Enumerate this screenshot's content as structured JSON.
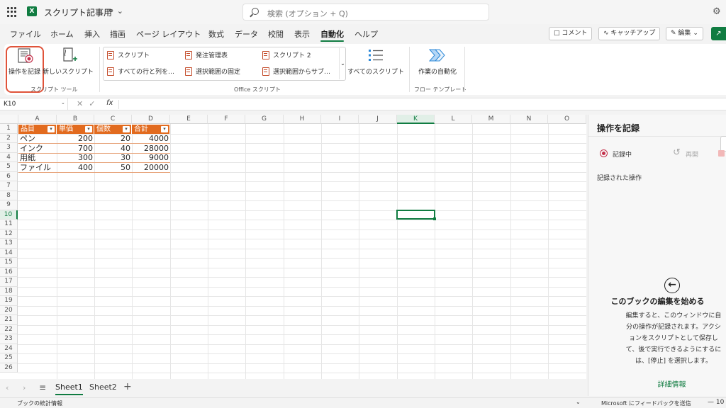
{
  "titlebar": {
    "app_icon": "excel-icon",
    "doc_title": "スクリプト記事用",
    "search_placeholder": "検索 (オプション + Q)"
  },
  "menu": {
    "tabs": [
      "ファイル",
      "ホーム",
      "挿入",
      "描画",
      "ページ レイアウト",
      "数式",
      "データ",
      "校閲",
      "表示",
      "自動化",
      "ヘルプ"
    ],
    "active_tab": "自動化",
    "comment_btn": "コメント",
    "catchup_btn": "キャッチアップ",
    "edit_btn": "編集"
  },
  "ribbon": {
    "record_actions": "操作を記録",
    "new_script": "新しいスクリプト",
    "script_tools_group": "スクリプト ツール",
    "gallery": [
      [
        "スクリプト",
        "発注管理表",
        "スクリプト 2"
      ],
      [
        "すべての行と列を…",
        "選択範囲の固定",
        "選択範囲からサブ…"
      ]
    ],
    "office_scripts_group": "Office スクリプト",
    "all_scripts": "すべてのスクリプト",
    "automate_work": "作業の自動化",
    "flow_templates_group": "フロー テンプレート"
  },
  "formula_bar": {
    "name_box": "K10",
    "fx": "fx",
    "value": ""
  },
  "grid": {
    "columns": [
      "A",
      "B",
      "C",
      "D",
      "E",
      "F",
      "G",
      "H",
      "I",
      "J",
      "K",
      "L",
      "M",
      "N",
      "O"
    ],
    "rows": [
      "1",
      "2",
      "3",
      "4",
      "5",
      "6",
      "7",
      "8",
      "9",
      "10",
      "11",
      "12",
      "13",
      "14",
      "15",
      "16",
      "17",
      "18",
      "19",
      "20",
      "21",
      "22",
      "23",
      "24",
      "25",
      "26"
    ],
    "selected_cell": "K10",
    "table_headers": [
      "品目",
      "単価",
      "個数",
      "合計"
    ],
    "table_rows": [
      [
        "ペン",
        "200",
        "20",
        "4000"
      ],
      [
        "インク",
        "700",
        "40",
        "28000"
      ],
      [
        "用紙",
        "300",
        "30",
        "9000"
      ],
      [
        "ファイル",
        "400",
        "50",
        "20000"
      ]
    ],
    "table_color": "#e26b1f"
  },
  "sheets": {
    "tabs": [
      "Sheet1",
      "Sheet2"
    ],
    "active": "Sheet1"
  },
  "status": {
    "left": "ブックの統計情報",
    "feedback": "Microsoft にフィードバックを送信",
    "zoom": "— 10"
  },
  "pane": {
    "title": "操作を記録",
    "recording": "記録中",
    "replay": "再開",
    "recorded_actions": "記録された操作",
    "empty_title": "このブックの編集を始める",
    "empty_desc": "編集すると、このウィンドウに自分の操作が記録されます。アクションをスクリプトとして保存して、後で実行できるようにするには、[停止] を選択します。",
    "details_link": "詳細情報"
  },
  "colors": {
    "accent": "#107c41",
    "highlight_outline": "#e0533a"
  }
}
